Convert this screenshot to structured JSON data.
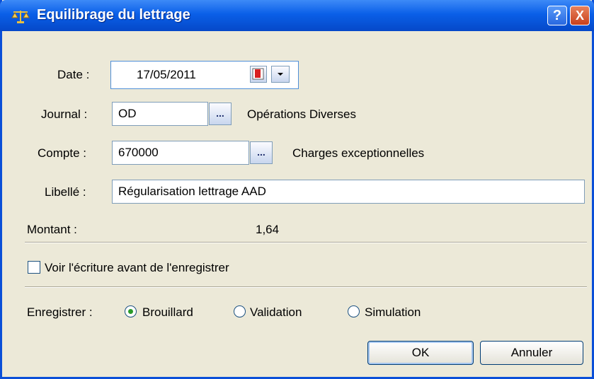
{
  "window": {
    "title": "Equilibrage du lettrage",
    "help_label": "?",
    "close_label": "X"
  },
  "form": {
    "date": {
      "label": "Date :",
      "value": "17/05/2011",
      "calendar_label": "1",
      "dropdown_label": "▾"
    },
    "journal": {
      "label": "Journal :",
      "value": "OD",
      "browse_label": "...",
      "description": "Opérations Diverses"
    },
    "compte": {
      "label": "Compte :",
      "value": "670000",
      "browse_label": "...",
      "description": "Charges exceptionnelles"
    },
    "libelle": {
      "label": "Libellé :",
      "value": "Régularisation lettrage AAD"
    },
    "montant": {
      "label": "Montant :",
      "value": "1,64"
    }
  },
  "options": {
    "voir_ecriture_label": "Voir l'écriture avant de l'enregistrer",
    "voir_ecriture_checked": false,
    "enregistrer_label": "Enregistrer :",
    "radios": [
      {
        "label": "Brouillard",
        "selected": true
      },
      {
        "label": "Validation",
        "selected": false
      },
      {
        "label": "Simulation",
        "selected": false
      }
    ]
  },
  "buttons": {
    "ok": "OK",
    "cancel": "Annuler"
  },
  "colors": {
    "titlebar": "#0a5fe8",
    "dialog_bg": "#ece9d8",
    "radio_dot": "#2a9a2a",
    "close": "#c8401c"
  },
  "icons": {
    "title": "balance-scale-icon",
    "calendar": "calendar-icon"
  }
}
